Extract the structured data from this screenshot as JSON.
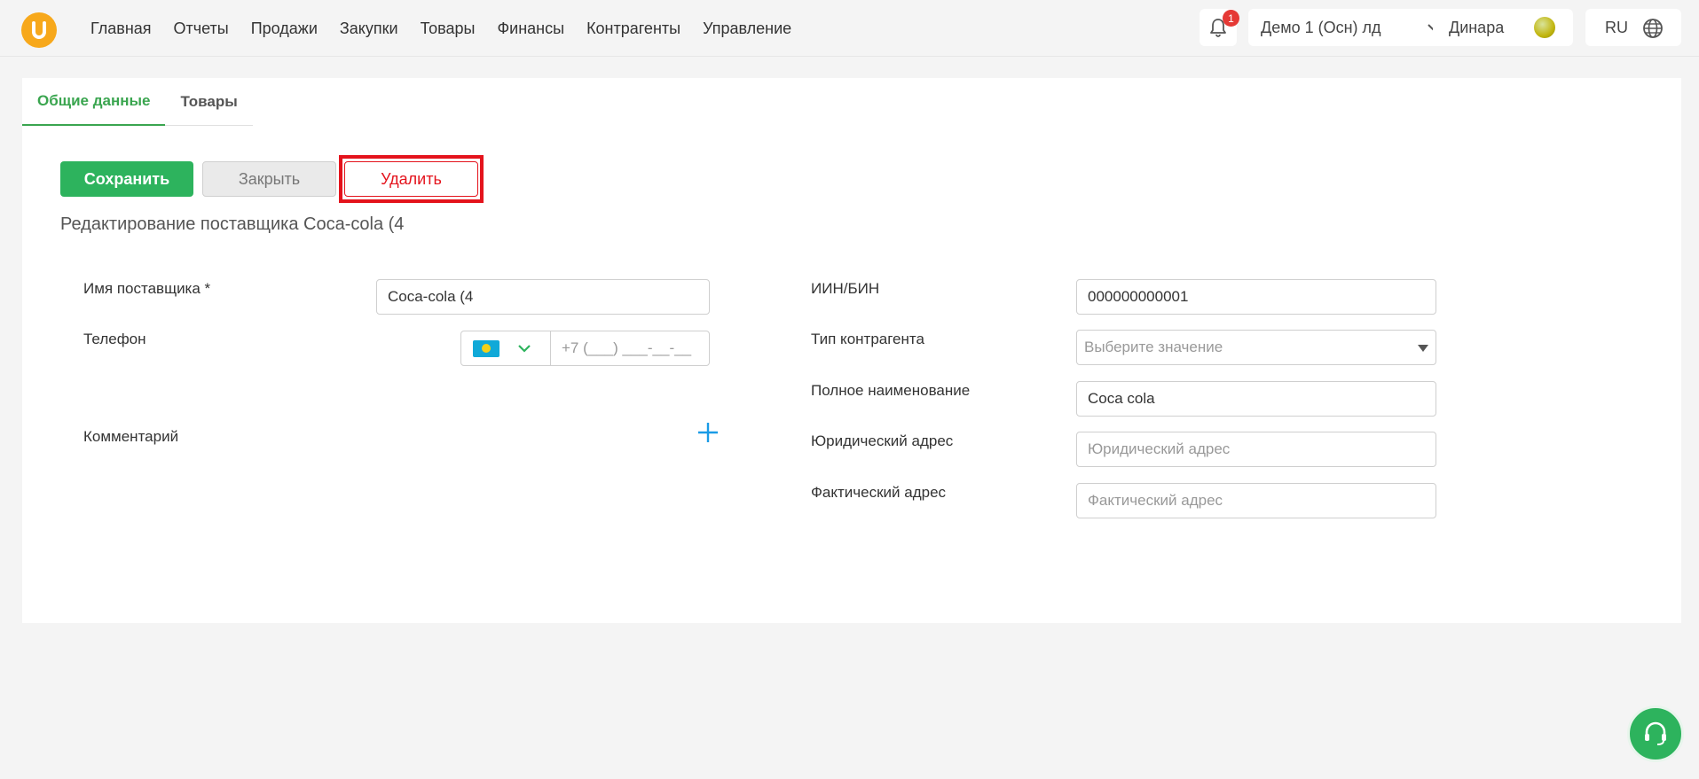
{
  "nav": {
    "items": [
      "Главная",
      "Отчеты",
      "Продажи",
      "Закупки",
      "Товары",
      "Финансы",
      "Контрагенты",
      "Управление"
    ],
    "notifications_count": "1",
    "company": "Демо 1 (Осн) лд",
    "user": "Динара",
    "language": "RU"
  },
  "tabs": [
    "Общие данные",
    "Товары"
  ],
  "actions": {
    "save": "Сохранить",
    "close": "Закрыть",
    "delete": "Удалить"
  },
  "subtitle": "Редактирование поставщика Coca-cola (4",
  "form_left": {
    "name_label": "Имя поставщика *",
    "name_value": "Coca-cola (4",
    "phone_label": "Телефон",
    "phone_placeholder": "+7 (___) ___-__-__",
    "comment_label": "Комментарий"
  },
  "form_right": {
    "iin_label": "ИИН/БИН",
    "iin_value": "000000000001",
    "type_label": "Тип контрагента",
    "type_placeholder": "Выберите значение",
    "fullname_label": "Полное наименование",
    "fullname_value": "Coca cola",
    "legal_address_label": "Юридический адрес",
    "legal_address_placeholder": "Юридический адрес",
    "actual_address_label": "Фактический адрес",
    "actual_address_placeholder": "Фактический адрес"
  },
  "colors": {
    "accent_green": "#2db35d",
    "tab_green": "#3aa54f",
    "danger_red": "#e4131c",
    "logo_orange": "#f7a81b",
    "plus_blue": "#1a9be6"
  }
}
